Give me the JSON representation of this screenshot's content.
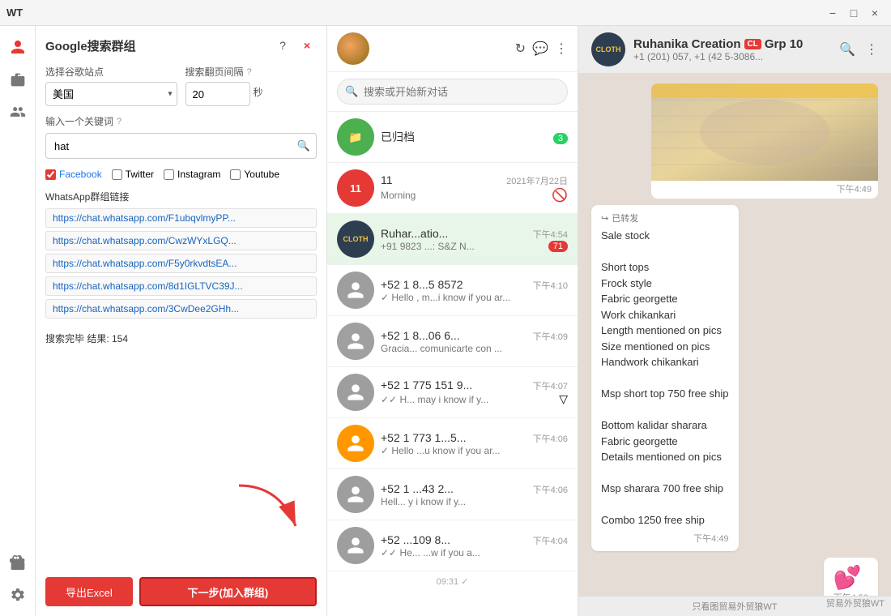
{
  "titleBar": {
    "title": "WT",
    "minimize": "−",
    "maximize": "□",
    "close": "×"
  },
  "leftPanel": {
    "title": "Google搜索群组",
    "helpIcon": "?",
    "closeIcon": "×",
    "siteLabel": "选择谷歌站点",
    "intervalLabel": "搜索翻页间隔",
    "intervalHelp": "?",
    "site": "美国",
    "interval": "20",
    "unit": "秒",
    "keywordLabel": "输入一个关键词",
    "keywordHelp": "?",
    "keywordValue": "hat",
    "checkboxes": [
      {
        "id": "cb-facebook",
        "label": "Facebook",
        "checked": true
      },
      {
        "id": "cb-twitter",
        "label": "Twitter",
        "checked": false
      },
      {
        "id": "cb-instagram",
        "label": "Instagram",
        "checked": false
      },
      {
        "id": "cb-youtube",
        "label": "Youtube",
        "checked": false
      }
    ],
    "groupLinksLabel": "WhatsApp群组链接",
    "links": [
      "https://chat.whatsapp.com/F1ubqvlmyPP...",
      "https://chat.whatsapp.com/CwzWYxLGQ...",
      "https://chat.whatsapp.com/F5y0rkvdtsEA...",
      "https://chat.whatsapp.com/8d1IGLTVC39J...",
      "https://chat.whatsapp.com/3CwDee2GHh..."
    ],
    "statusText": "搜索完毕 结果: 154",
    "exportBtn": "导出Excel",
    "nextBtn": "下一步(加入群组)"
  },
  "chatPanel": {
    "searchPlaceholder": "搜索或开始新对话",
    "items": [
      {
        "id": "archived",
        "name": "已归档",
        "time": "",
        "msg": "",
        "badge": "3",
        "badgeColor": "green",
        "type": "archived"
      },
      {
        "id": "chat-11",
        "name": "11",
        "time": "2021年7月22日",
        "msg": "Morning",
        "badge": "",
        "type": "red"
      },
      {
        "id": "chat-ruhan",
        "name": "Ruhar...atio...",
        "time": "下午4:54",
        "msg": "+91 9823 ...: S&Z N...",
        "badge": "71",
        "badgeColor": "red",
        "type": "cloth"
      },
      {
        "id": "chat-52-1",
        "name": "+52 1 8...5 8572",
        "time": "下午4:10",
        "msg": "✓ Hello , m...i know if you ar...",
        "badge": "",
        "type": "gray"
      },
      {
        "id": "chat-52-2",
        "name": "+52 1 8...06 6...",
        "time": "下午4:09",
        "msg": "Gracia... comunicarte con ...",
        "badge": "",
        "type": "gray"
      },
      {
        "id": "chat-52-3",
        "name": "+52 1 775 151 9...",
        "time": "下午4:07",
        "msg": "✓✓ H... may i know if y...",
        "badge": "",
        "type": "gray"
      },
      {
        "id": "chat-52-4",
        "name": "+52 1 773 1...5...",
        "time": "下午4:06",
        "msg": "✓ Hello  ...u know if you ar...",
        "badge": "",
        "type": "orange"
      },
      {
        "id": "chat-52-5",
        "name": "+52 1 ...43 2...",
        "time": "下午4:06",
        "msg": "Hell...  y i know if y...",
        "badge": "",
        "type": "gray"
      },
      {
        "id": "chat-52-6",
        "name": "+52 ...109 8...",
        "time": "下午4:04",
        "msg": "✓✓ He...  ...w if you a...",
        "badge": "",
        "type": "gray"
      }
    ],
    "timeAtBottom": "09:31 ✓"
  },
  "chatView": {
    "name": "Ruhanika Creation",
    "badgeCL": "CL",
    "groupName": "Grp 10",
    "status": "+1 (201)    057, +1 (42   5-3086...",
    "searchIcon": "🔍",
    "moreIcon": "⋮",
    "messages": [
      {
        "type": "image",
        "time": "下午4:49"
      },
      {
        "type": "text",
        "forwarded": true,
        "forwardedLabel": "已转发",
        "text": "Sale stock\n\nShort tops\nFrock style\nFabric georgette\nWork chikankari\nLength mentioned on pics\nSize mentioned on pics\nHandwork chikankari\n\nMsp short top 750 free ship\n\nBottom kalidar sharara\nFabric georgette\nDetails mentioned on pics\n\nMsp sharara 700 free ship\n\nCombo 1250 free ship",
        "time": "下午4:49"
      },
      {
        "type": "hearts",
        "emoji": "💕",
        "time": "下午4:50"
      }
    ],
    "footerNote": "只看图贸易外贸狼WT",
    "watermark": "贸易外贸狼WT"
  },
  "icons": {
    "user": "👤",
    "briefcase": "💼",
    "people": "👥",
    "settings": "⚙",
    "gift": "🎁",
    "search": "🔍",
    "refresh": "↻",
    "chat": "💬",
    "more": "⋮"
  }
}
